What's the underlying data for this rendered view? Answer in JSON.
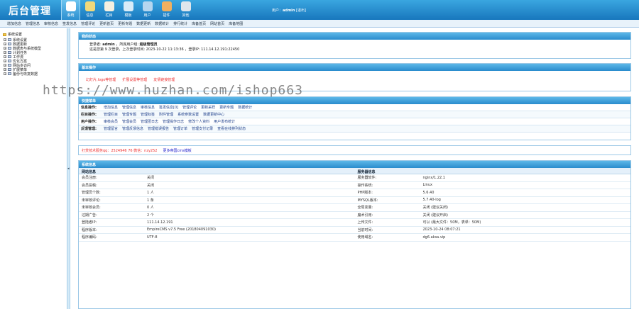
{
  "header": {
    "logo": "后台管理",
    "nav": [
      {
        "label": "系统",
        "icon": "home-icon",
        "color": "#ffffff"
      },
      {
        "label": "信息",
        "icon": "edit-icon",
        "color": "#f1d97b"
      },
      {
        "label": "栏目",
        "icon": "folder-icon",
        "color": "#f6f0e0"
      },
      {
        "label": "模板",
        "icon": "template-icon",
        "color": "#d8ecf8"
      },
      {
        "label": "用户",
        "icon": "user-icon",
        "color": "#b5d6ef"
      },
      {
        "label": "插件",
        "icon": "plugin-icon",
        "color": "#f0b060"
      },
      {
        "label": "其他",
        "icon": "gear-icon",
        "color": "#dfe6ec"
      }
    ],
    "user_prefix": "用户：",
    "user_name": "admin",
    "logout": "[退出]"
  },
  "subnav": [
    "增加信息",
    "管理信息",
    "审核信息",
    "签发信息",
    "管理评论",
    "更新首页",
    "更新专题",
    "数据更新",
    "数据统计",
    "排行统计",
    "库备首页",
    "网站首页",
    "库备地图"
  ],
  "sidebar": {
    "title": "系统设置",
    "items": [
      "系统设置",
      "数据更新",
      "数据表与系统模型",
      "计划任务",
      "工作流",
      "优化方案",
      "网站多访问",
      "扩展菜单",
      "备份与恢复数据"
    ]
  },
  "splitter": "◂",
  "panel_login": {
    "title": "我的状态",
    "l1_a": "登录者:",
    "l1_user": "admin",
    "l1_b": "，所属用户组:",
    "l1_group": "超级管理员",
    "l2": "这是您第 9 次登录，上次登录时间: 2023-10-22 11:13:36 ，登录IP: 111.14.12.191:22450"
  },
  "panel_basic": {
    "title": "基本操作",
    "links": [
      "幻灯片,logo等管理",
      "扩展设置等管理",
      "友情链接管理"
    ]
  },
  "panel_fast": {
    "title": "快捷菜单",
    "rows": [
      {
        "label": "信息操作:",
        "items": [
          "增加信息",
          "管理信息",
          "审核信息",
          "签发信息[0]",
          "管理评论",
          "更新采样",
          "更新专题",
          "数据统计"
        ]
      },
      {
        "label": "栏目操作:",
        "items": [
          "管理栏目",
          "管理专题",
          "管理标签",
          "附件管理",
          "系统参数设置",
          "数据更新中心"
        ]
      },
      {
        "label": "用户操作:",
        "items": [
          "审核会员",
          "管理会员",
          "管理团日志",
          "管理操作日志",
          "修改个人资料",
          "用户发布统计"
        ]
      },
      {
        "label": "反馈管理:",
        "items": [
          "管理留言",
          "管理反馈信息",
          "管理错误报告",
          "管理订单",
          "管理支付记录",
          "查看在线排列状态"
        ]
      }
    ]
  },
  "panel_contact": {
    "red": "打赏技术服务qq：2524946 76 微信：nzy252",
    "blue": "更多帝国cms模板"
  },
  "panel_sys": {
    "title": "系统信息",
    "left_head": "网站信息",
    "right_head": "服务器信息",
    "left": [
      [
        "会员注册:",
        "关闭"
      ],
      [
        "会员投稿:",
        "关闭"
      ],
      [
        "管理员个数:",
        "1 人"
      ],
      [
        "未审核评论:",
        "1 条"
      ],
      [
        "未审核会员:",
        "0 人"
      ],
      [
        "过期广告:",
        "2 个"
      ],
      [
        "登陆者IP:",
        "111.14.12.191"
      ],
      [
        "程序版本:",
        "EmpireCMS v7.5 Free (201804091030)"
      ],
      [
        "程序编码:",
        "UTF-8"
      ]
    ],
    "right": [
      [
        "服务器软件:",
        "nginx/1.22.1"
      ],
      [
        "操作系统:",
        "Linux"
      ],
      [
        "PHP版本:",
        "5.6.40"
      ],
      [
        "MYSQL版本:",
        "5.7.40-log"
      ],
      [
        "全局变量:",
        "关闭 (建议关闭)"
      ],
      [
        "魔术引用:",
        "关闭 (建议开启)"
      ],
      [
        "上传文件:",
        "可以 (最大文件：50M，表单：50M)"
      ],
      [
        "当前时间:",
        "2023-10-24 08:07:21"
      ],
      [
        "使用域名:",
        "dg6.aksa.vip"
      ]
    ]
  },
  "watermark": "https://www.huzhan.com/ishop663"
}
